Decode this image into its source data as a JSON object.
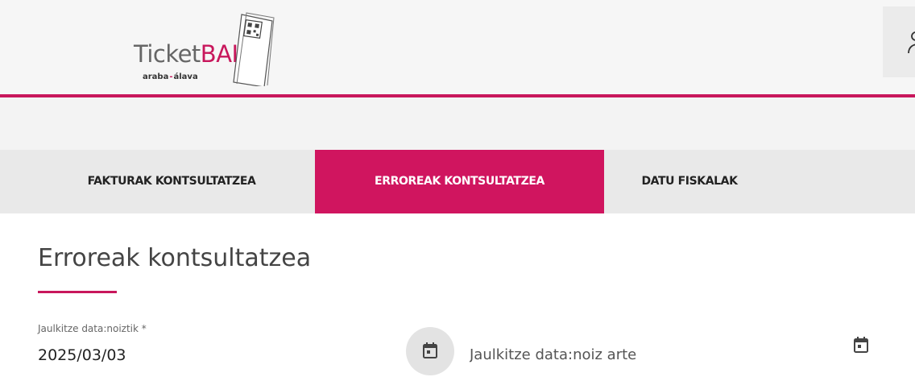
{
  "header": {
    "logo": {
      "word_part1": "Ticket",
      "word_part2": "BAI",
      "sub_left": "araba",
      "sub_sep": "-",
      "sub_right": "álava"
    }
  },
  "colors": {
    "accent": "#c8175c",
    "tab_bar": "#e9e9e9",
    "header_bg": "#f6f6f6"
  },
  "tabs": [
    {
      "label": "FAKTURAK KONTSULTATZEA",
      "active": false
    },
    {
      "label": "ERROREAK KONTSULTATZEA",
      "active": true
    },
    {
      "label": "DATU FISKALAK",
      "active": false
    }
  ],
  "main": {
    "title": "Erroreak kontsultatzea",
    "from_field": {
      "label": "Jaulkitze data:noiztik *",
      "value": "2025/03/03",
      "icon": "calendar-icon"
    },
    "to_field": {
      "placeholder": "Jaulkitze data:noiz arte",
      "value": "",
      "icon": "calendar-icon"
    }
  }
}
